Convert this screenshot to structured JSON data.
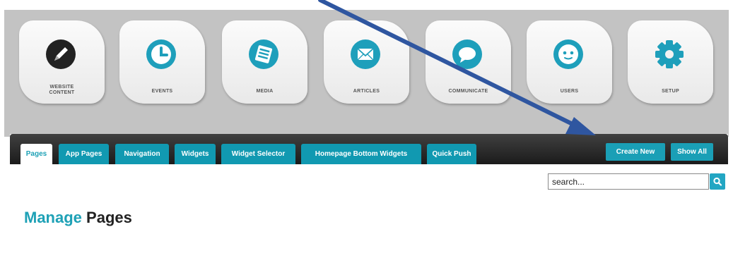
{
  "toolbar": {
    "tiles": [
      {
        "label_1": "WEBSITE",
        "label_2": "CONTENT",
        "icon": "pencil-icon",
        "color": "#222222"
      },
      {
        "label": "EVENTS",
        "icon": "clock-icon",
        "color": "#1e9fbb"
      },
      {
        "label": "MEDIA",
        "icon": "media-icon",
        "color": "#1e9fbb"
      },
      {
        "label": "ARTICLES",
        "icon": "envelope-icon",
        "color": "#1e9fbb"
      },
      {
        "label": "COMMUNICATE",
        "icon": "speech-bubble-icon",
        "color": "#1e9fbb"
      },
      {
        "label": "USERS",
        "icon": "face-icon",
        "color": "#1e9fbb"
      },
      {
        "label": "SETUP",
        "icon": "gear-icon",
        "color": "#1e9fbb"
      }
    ]
  },
  "tabs": [
    {
      "label": "Pages",
      "active": true
    },
    {
      "label": "App Pages"
    },
    {
      "label": "Navigation"
    },
    {
      "label": "Widgets"
    },
    {
      "label": "Widget Selector"
    },
    {
      "label": "Homepage Bottom Widgets"
    },
    {
      "label": "Quick Push"
    }
  ],
  "actions": {
    "create_new": "Create New",
    "show_all": "Show All"
  },
  "search": {
    "placeholder": "search..."
  },
  "heading": {
    "part_1": "Manage",
    "part_2": "Pages"
  },
  "colors": {
    "accent": "#1a9fb6",
    "annotation_arrow": "#2f56a0"
  }
}
